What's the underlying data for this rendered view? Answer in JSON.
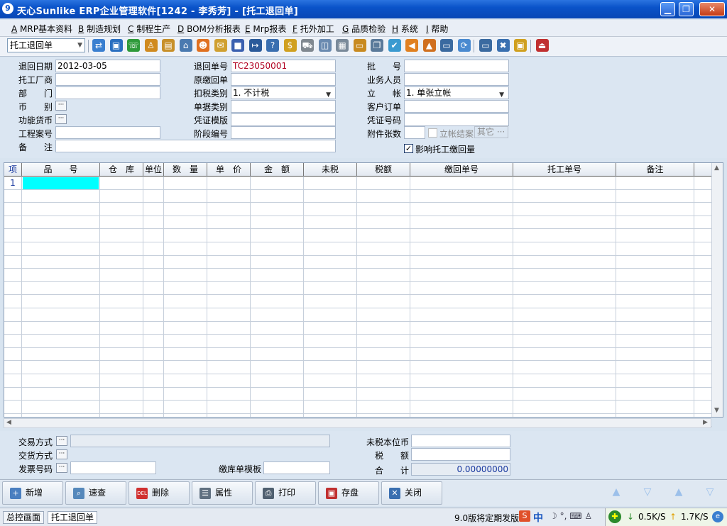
{
  "window": {
    "title": "天心Sunlike ERP企业管理软件[1242 - 李秀芳] - [托工退回单]",
    "minimize": "▁",
    "restore": "❐",
    "close": "✕"
  },
  "menu": [
    {
      "key": "A",
      "label": "MRP基本资料"
    },
    {
      "key": "B",
      "label": "制造规划"
    },
    {
      "key": "C",
      "label": "制程生产"
    },
    {
      "key": "D",
      "label": "BOM分析报表"
    },
    {
      "key": "E",
      "label": "Mrp报表"
    },
    {
      "key": "F",
      "label": "托外加工"
    },
    {
      "key": "G",
      "label": "品质检验"
    },
    {
      "key": "H",
      "label": "系统"
    },
    {
      "key": "I",
      "label": "帮助"
    }
  ],
  "toolbar": {
    "form_select": "托工退回单",
    "icons": [
      "transfer-icon",
      "computer-icon",
      "phone-icon",
      "lock-folder-icon",
      "briefcase-icon",
      "home-icon",
      "users-icon",
      "mail-icon",
      "book-icon",
      "key-icon",
      "help-icon",
      "money-icon",
      "cart-icon",
      "copy-doc-icon",
      "calculator-icon",
      "drawer-icon",
      "pages-icon",
      "check-circle-icon",
      "bell-icon",
      "hierarchy-icon",
      "monitor-icon",
      "refresh-icon",
      "window-icon",
      "close-window-icon",
      "tile-icon",
      "exit-icon"
    ]
  },
  "header": {
    "return_date_label": "退回日期",
    "return_date": "2012-03-05",
    "vendor_label": "托工厂商",
    "vendor": "",
    "dept_label": "部　　门",
    "dept": "",
    "currency_label": "币　　别",
    "func_currency_label": "功能货币",
    "project_label": "工程案号",
    "project": "",
    "remark_label": "备　　注",
    "remark": "",
    "return_no_label": "退回单号",
    "return_no": "TC23050001",
    "orig_return_label": "原缴回单",
    "orig_return": "",
    "tax_type_label": "扣税类别",
    "tax_type": "1. 不计税",
    "doc_type_label": "单据类别",
    "doc_type": "",
    "voucher_tpl_label": "凭证模版",
    "voucher_tpl": "",
    "stage_no_label": "阶段编号",
    "stage_no": "",
    "batch_label": "批　　号",
    "batch": "",
    "salesman_label": "业务人员",
    "salesman": "",
    "account_label": "立　　帐",
    "account": "1. 单张立帐",
    "cust_order_label": "客户订单",
    "cust_order": "",
    "voucher_no_label": "凭证号码",
    "voucher_no": "",
    "attach_label": "附件张数",
    "attach": "",
    "settle_label": "立帐结案",
    "other_label": "其它",
    "affect_label": "影响托工缴回量"
  },
  "grid": {
    "columns": [
      "项",
      "品　　号",
      "仓　库",
      "单位",
      "数　量",
      "单　价",
      "金　额",
      "未税",
      "税额",
      "缴回单号",
      "托工单号",
      "备注"
    ],
    "rows": [
      {
        "item": "1"
      }
    ],
    "empty_rows": 18
  },
  "footer": {
    "trade_label": "交易方式",
    "trade": "",
    "delivery_label": "交货方式",
    "invoice_label": "发票号码",
    "invoice": "",
    "tpl_label": "缴库单模板",
    "tpl": "",
    "untaxed_label": "未税本位币",
    "untaxed": "",
    "tax_label": "税　　额",
    "tax": "",
    "total_label": "合　　计",
    "total": "0.00000000"
  },
  "buttons": [
    {
      "label": "新增",
      "icon": "plus-icon",
      "color": "#4a7fc0"
    },
    {
      "label": "速查",
      "icon": "magnifier-icon",
      "color": "#5588bb"
    },
    {
      "label": "删除",
      "icon": "delete-icon",
      "color": "#d03030"
    },
    {
      "label": "属性",
      "icon": "properties-icon",
      "color": "#607080"
    },
    {
      "label": "打印",
      "icon": "printer-icon",
      "color": "#506070"
    },
    {
      "label": "存盘",
      "icon": "save-icon",
      "color": "#c03030"
    },
    {
      "label": "关闭",
      "icon": "close-icon",
      "color": "#3a6fb0"
    }
  ],
  "status": {
    "home": "总控画面",
    "tab": "托工退回单",
    "notice": "9.0版将定期发版",
    "ime": "中",
    "down": "0.5K/S",
    "up": "1.7K/S"
  }
}
